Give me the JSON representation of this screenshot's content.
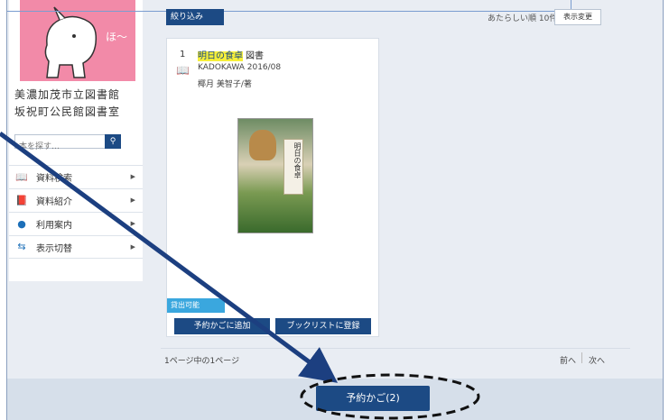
{
  "sidebar": {
    "logo_text": "ほ〜",
    "library_name_line1": "美濃加茂市立図書館",
    "library_name_line2": "坂祝町公民館図書室",
    "search": {
      "placeholder": "本を探す…",
      "button_icon": "search-icon"
    },
    "menu": [
      {
        "label": "資料検索",
        "icon": "search-book-icon"
      },
      {
        "label": "資料紹介",
        "icon": "open-book-icon"
      },
      {
        "label": "利用案内",
        "icon": "person-icon"
      },
      {
        "label": "表示切替",
        "icon": "switch-icon"
      }
    ]
  },
  "toolbar": {
    "filter_label": "絞り込み",
    "sort_label": "あたらしい順 10件",
    "display_change_label": "表示変更"
  },
  "result": {
    "index": "1",
    "title_highlight": "明日の食卓",
    "material_type": "図書",
    "publisher_date": "KADOKAWA 2016/08",
    "author": "椰月 美智子/著",
    "cover_title": "明日の食卓",
    "availability": "貸出可能",
    "reserve_label": "予約かごに追加",
    "booklist_label": "ブックリストに登録"
  },
  "pagination": {
    "summary": "1ページ中の1ページ",
    "prev_label": "前へ",
    "next_label": "次へ"
  },
  "footer": {
    "basket_label": "予約かご(2)"
  },
  "colors": {
    "primary": "#1c4a84",
    "available": "#3aa7de",
    "highlight": "#f6ef3a",
    "logo_bg": "#f28aa8",
    "annotation": "#1c3f80"
  }
}
